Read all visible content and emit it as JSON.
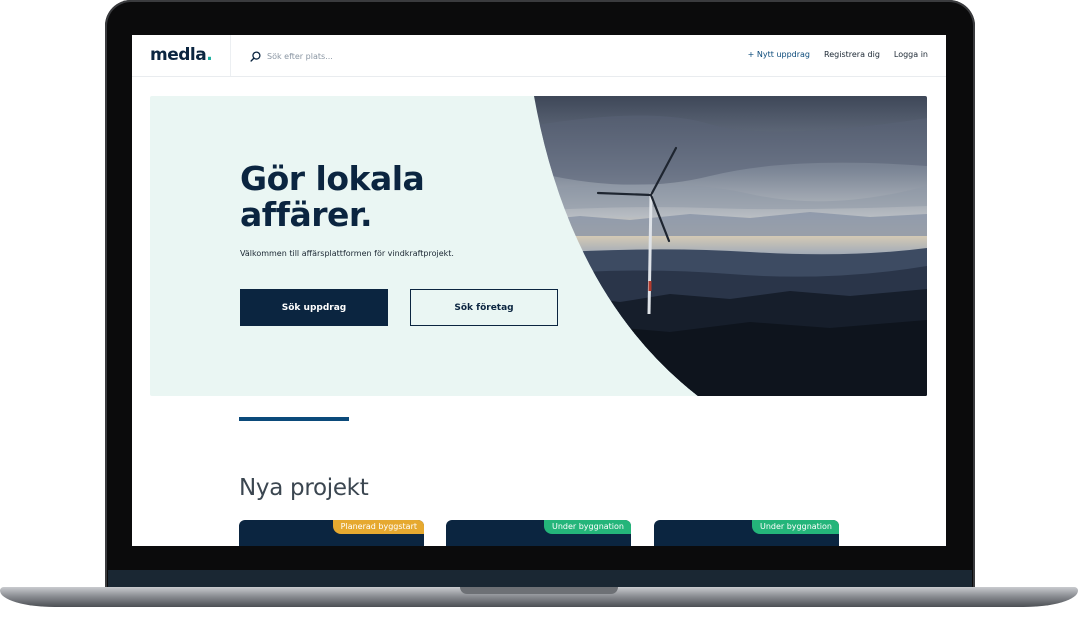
{
  "app": {
    "logo": "medla",
    "logo_dot": "."
  },
  "search": {
    "placeholder": "Sök efter plats...",
    "icon": "search-icon"
  },
  "nav": {
    "new_assignment": "+ Nytt uppdrag",
    "register": "Registrera dig",
    "login": "Logga in"
  },
  "hero": {
    "title_line1": "Gör lokala",
    "title_line2": "affärer.",
    "subtitle": "Välkommen till affärsplattformen för vindkraftprojekt.",
    "primary_button": "Sök uppdrag",
    "secondary_button": "Sök företag"
  },
  "projects": {
    "title": "Nya projekt",
    "cards": [
      {
        "badge": "Planerad byggstart",
        "badge_color": "#e6a930"
      },
      {
        "badge": "Under byggnation",
        "badge_color": "#24b57a"
      },
      {
        "badge": "Under byggnation",
        "badge_color": "#24b57a"
      }
    ]
  },
  "colors": {
    "brand": "#0b2540",
    "accent": "#1db0a0",
    "hero_bg": "#eaf6f3",
    "link": "#0b4a7a"
  }
}
